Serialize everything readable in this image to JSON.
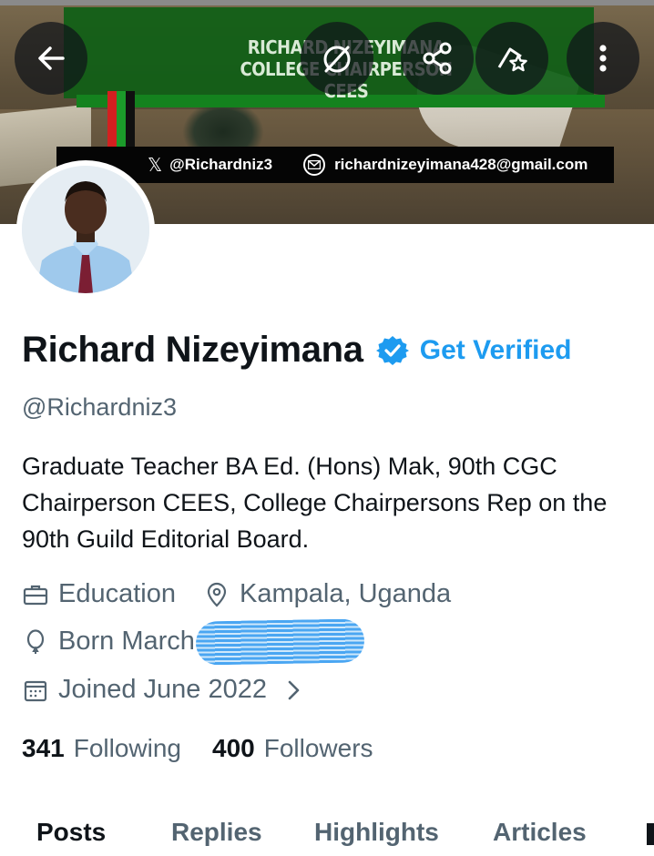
{
  "banner": {
    "title_line1": "RICHARD NIZEYIMANA",
    "title_line2": "COLLEGE CHAIRPERSON CEES",
    "x_glyph": "𝕏",
    "x_handle": "@Richardniz3",
    "email": "richardnizeyimana428@gmail.com",
    "flag_colors": [
      "#d32020",
      "#1b9b2a",
      "#101010"
    ]
  },
  "toolbar": {
    "back_icon": "back-arrow-icon",
    "grok_icon": "grok-icon",
    "share_icon": "share-icon",
    "bookmark_icon": "bookmark-star-icon",
    "more_icon": "more-vertical-icon"
  },
  "profile": {
    "name": "Richard Nizeyimana",
    "get_verified": "Get Verified",
    "handle": "@Richardniz3",
    "bio": "Graduate Teacher BA Ed. (Hons) Mak, 90th CGC Chairperson CEES, College Chairpersons Rep on the 90th Guild Editorial Board.",
    "category": "Education",
    "location": "Kampala, Uganda",
    "born": "Born March",
    "joined": "Joined June 2022"
  },
  "stats": {
    "following_count": "341",
    "following_label": "Following",
    "followers_count": "400",
    "followers_label": "Followers"
  },
  "tabs": [
    {
      "label": "Posts",
      "active": true
    },
    {
      "label": "Replies",
      "active": false
    },
    {
      "label": "Highlights",
      "active": false
    },
    {
      "label": "Articles",
      "active": false
    }
  ],
  "colors": {
    "accent": "#1d9bf0",
    "text_primary": "#0f1419",
    "text_secondary": "#536471"
  }
}
